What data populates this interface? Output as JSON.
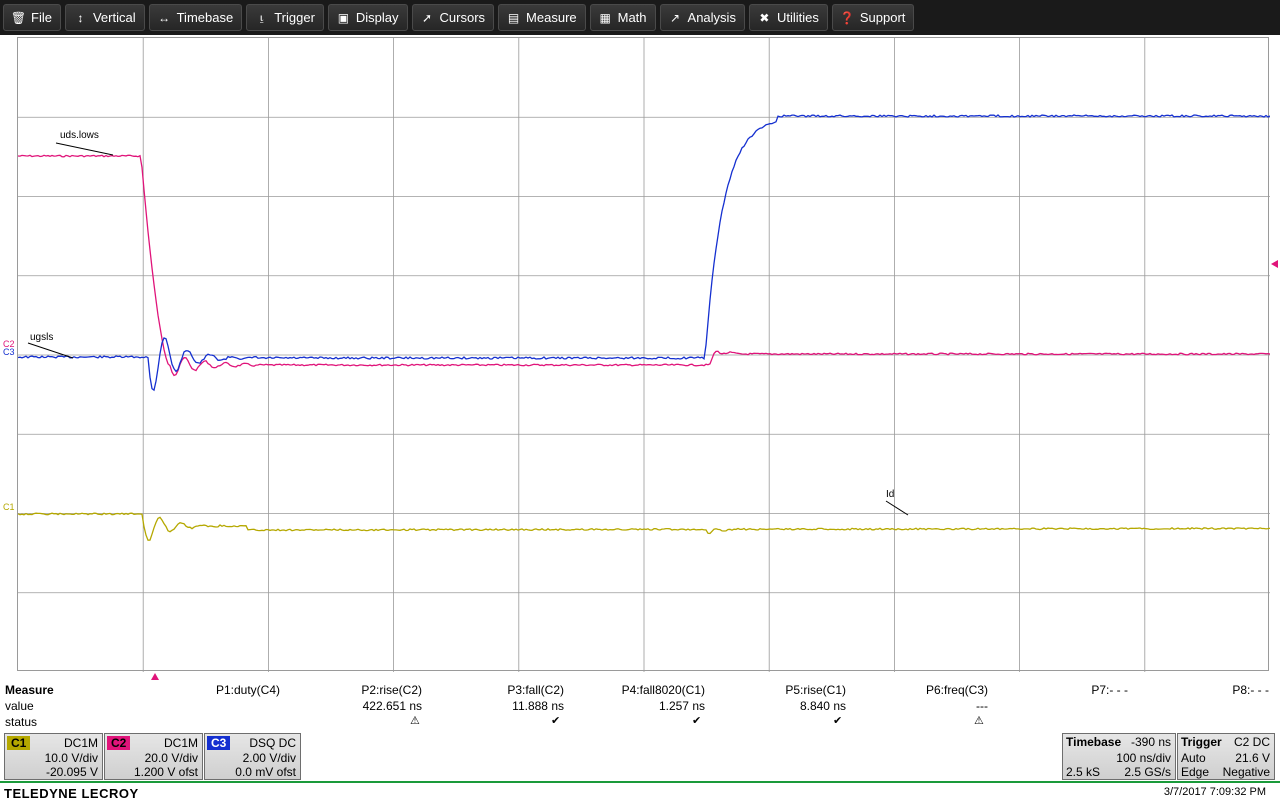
{
  "menu": [
    {
      "label": "File",
      "icon": "trash-icon"
    },
    {
      "label": "Vertical",
      "icon": "vertical-arrows-icon"
    },
    {
      "label": "Timebase",
      "icon": "horizontal-arrows-icon"
    },
    {
      "label": "Trigger",
      "icon": "trigger-icon"
    },
    {
      "label": "Display",
      "icon": "display-icon"
    },
    {
      "label": "Cursors",
      "icon": "cursor-icon"
    },
    {
      "label": "Measure",
      "icon": "measure-icon"
    },
    {
      "label": "Math",
      "icon": "calculator-icon"
    },
    {
      "label": "Analysis",
      "icon": "analysis-chart-icon"
    },
    {
      "label": "Utilities",
      "icon": "tools-icon"
    },
    {
      "label": "Support",
      "icon": "help-icon"
    }
  ],
  "colors": {
    "C1": "#b5a800",
    "C2": "#e0147a",
    "C3": "#1530d0",
    "grid": "#9a9a9a",
    "accent": "#1a9a3a"
  },
  "scope": {
    "channel_markers": {
      "c1": "C1",
      "c2": "C2",
      "c3": "C3"
    },
    "trace_labels": {
      "uds": "uds.lows",
      "ugs": "ugsls",
      "id": "Id"
    }
  },
  "measure": {
    "row_titles": {
      "title": "Measure",
      "value": "value",
      "status": "status"
    },
    "params": [
      {
        "name": "P1:duty(C4)",
        "value": "",
        "status": ""
      },
      {
        "name": "P2:rise(C2)",
        "value": "422.651 ns",
        "status": "warn"
      },
      {
        "name": "P3:fall(C2)",
        "value": "11.888 ns",
        "status": "ok"
      },
      {
        "name": "P4:fall8020(C1)",
        "value": "1.257 ns",
        "status": "ok"
      },
      {
        "name": "P5:rise(C1)",
        "value": "8.840 ns",
        "status": "ok"
      },
      {
        "name": "P6:freq(C3)",
        "value": "---",
        "status": "warn"
      },
      {
        "name": "P7:- - -",
        "value": "",
        "status": ""
      },
      {
        "name": "P8:- - -",
        "value": "",
        "status": ""
      }
    ]
  },
  "channels": [
    {
      "tag": "C1",
      "coupling": "DC1M",
      "vdiv": "10.0 V/div",
      "offset": "-20.095 V"
    },
    {
      "tag": "C2",
      "coupling": "DC1M",
      "vdiv": "20.0 V/div",
      "offset": "1.200 V ofst"
    },
    {
      "tag": "C3",
      "coupling": "DSQ  DC",
      "vdiv": "2.00 V/div",
      "offset": "0.0 mV ofst"
    }
  ],
  "timebase": {
    "title": "Timebase",
    "delay": "-390 ns",
    "tdiv": "100 ns/div",
    "samples": "2.5 kS",
    "rate": "2.5 GS/s"
  },
  "trigger": {
    "title": "Trigger",
    "source": "C2  DC",
    "mode": "Auto",
    "level": "21.6 V",
    "type": "Edge",
    "slope": "Negative"
  },
  "brand": "TELEDYNE LECROY",
  "datetime": "3/7/2017 7:09:32 PM"
}
